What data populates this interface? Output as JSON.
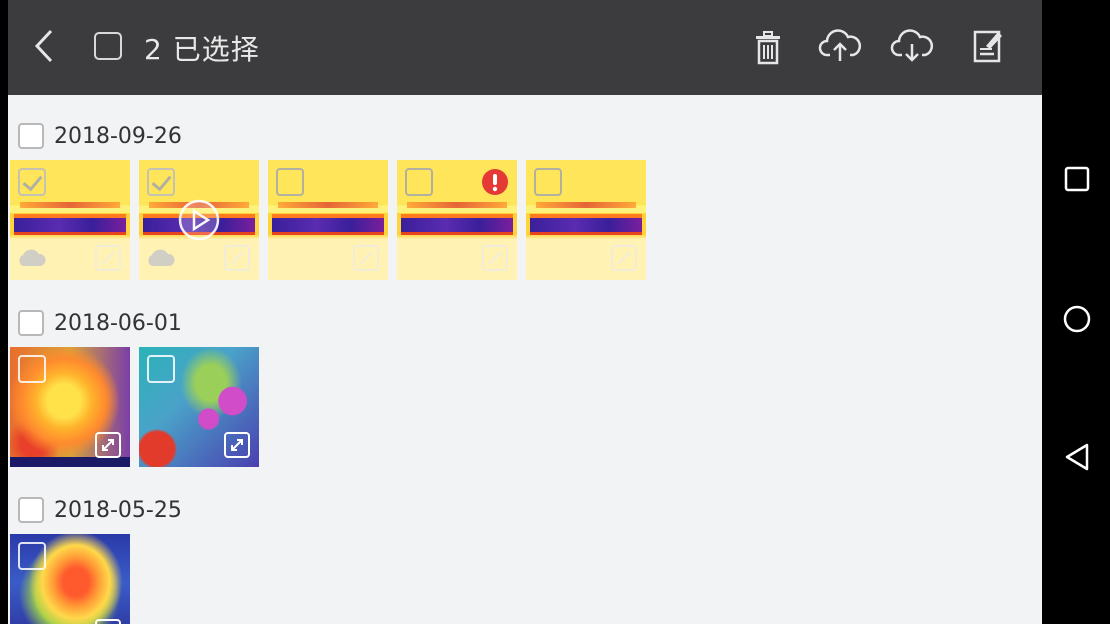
{
  "header": {
    "selected_label": "2 已选择",
    "icons": [
      "back-icon",
      "select-all-checkbox",
      "delete-icon",
      "cloud-upload-icon",
      "cloud-download-icon",
      "edit-icon"
    ]
  },
  "groups": [
    {
      "date": "2018-09-26",
      "items": [
        {
          "style": "yellow",
          "selected": true,
          "badge": "cloud"
        },
        {
          "style": "yellow",
          "selected": true,
          "badge": "cloud",
          "video": true
        },
        {
          "style": "yellow",
          "selected": false
        },
        {
          "style": "yellow",
          "selected": false,
          "alert": true
        },
        {
          "style": "yellow",
          "selected": false
        }
      ]
    },
    {
      "date": "2018-06-01",
      "items": [
        {
          "style": "pcb-warm",
          "selected": false,
          "expand": true
        },
        {
          "style": "pcb-cool",
          "selected": false,
          "expand": true
        }
      ]
    },
    {
      "date": "2018-05-25",
      "items": [
        {
          "style": "pcb-blue",
          "selected": false,
          "expand": true
        }
      ]
    }
  ],
  "colors": {
    "toolbar": "#3c3c3e",
    "content_bg": "#f1f3f5",
    "alert": "#e53935"
  },
  "system_nav": [
    "recent-apps-icon",
    "home-icon",
    "back-nav-icon"
  ]
}
